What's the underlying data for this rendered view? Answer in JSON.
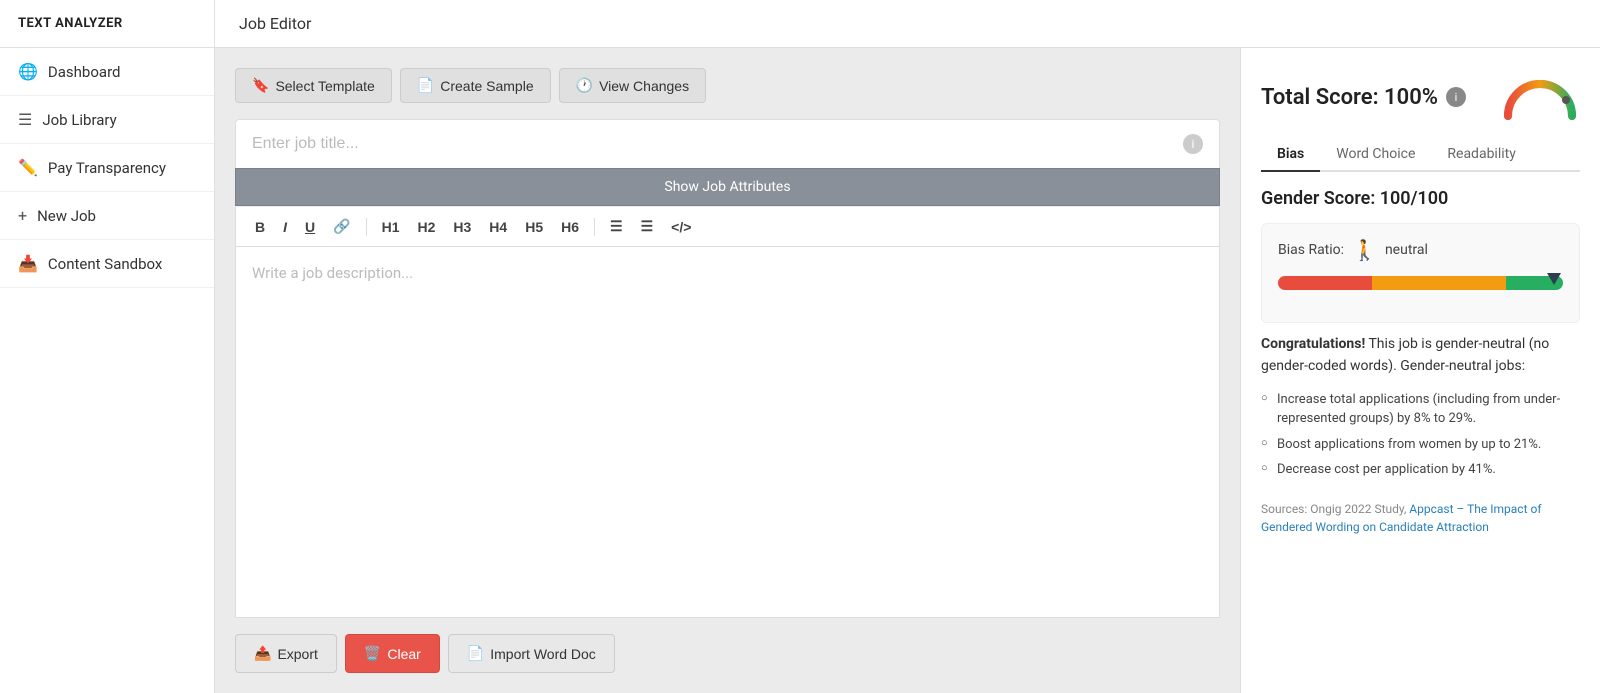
{
  "sidebar": {
    "title": "TEXT ANALYZER",
    "items": [
      {
        "id": "dashboard",
        "label": "Dashboard",
        "icon": "🌐"
      },
      {
        "id": "job-library",
        "label": "Job Library",
        "icon": "☰"
      },
      {
        "id": "pay-transparency",
        "label": "Pay Transparency",
        "icon": "✏️"
      },
      {
        "id": "new-job",
        "label": "New Job",
        "icon": "+"
      },
      {
        "id": "content-sandbox",
        "label": "Content Sandbox",
        "icon": "📥"
      }
    ]
  },
  "header": {
    "title": "Job Editor"
  },
  "toolbar": {
    "select_template_label": "Select Template",
    "create_sample_label": "Create Sample",
    "view_changes_label": "View Changes"
  },
  "editor": {
    "title_placeholder": "Enter job title...",
    "show_attributes_label": "Show Job Attributes",
    "description_placeholder": "Write a job description...",
    "rich_toolbar": {
      "bold": "B",
      "italic": "I",
      "underline": "U",
      "link": "🔗",
      "h1": "H1",
      "h2": "H2",
      "h3": "H3",
      "h4": "H4",
      "h5": "H5",
      "h6": "H6",
      "ul": "≡",
      "ol": "≡",
      "code": "</>"
    },
    "export_label": "Export",
    "clear_label": "Clear",
    "import_label": "Import Word Doc"
  },
  "score_panel": {
    "total_score_label": "Total Score: 100%",
    "tabs": [
      {
        "id": "bias",
        "label": "Bias",
        "active": true
      },
      {
        "id": "word-choice",
        "label": "Word Choice",
        "active": false
      },
      {
        "id": "readability",
        "label": "Readability",
        "active": false
      }
    ],
    "gender_score_label": "Gender Score: 100/100",
    "bias_ratio_label": "Bias Ratio:",
    "bias_ratio_status": "neutral",
    "congrats_message": " This job is gender-neutral (no gender-coded words). Gender-neutral jobs:",
    "congrats_bold": "Congratulations!",
    "benefits": [
      "Increase total applications (including from under-represented groups) by 8% to 29%.",
      "Boost applications from women by up to 21%.",
      "Decrease cost per application by 41%."
    ],
    "sources_text": "Sources: Ongig 2022 Study, ",
    "sources_link_label": "Appcast – The Impact of Gendered Wording on Candidate Attraction",
    "sources_link_url": "#"
  }
}
